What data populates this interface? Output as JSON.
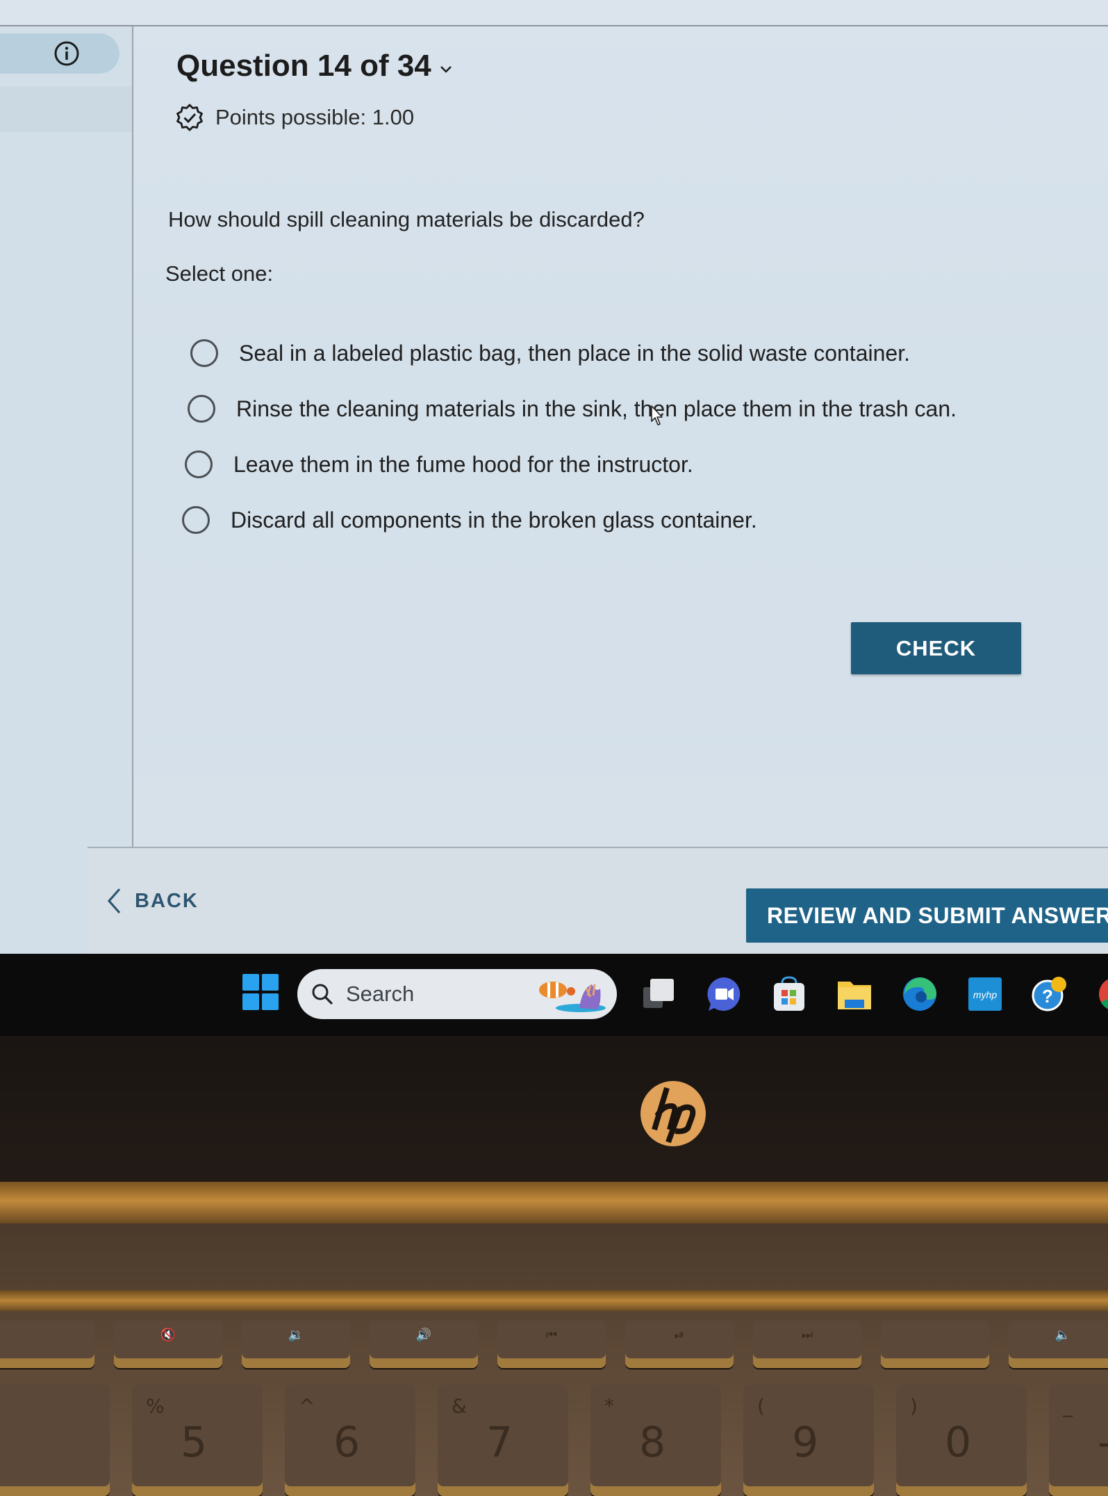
{
  "sidebar": {
    "info_icon": "info-circle-icon"
  },
  "header": {
    "question_title": "Question 14 of 34",
    "title_dropdown_icon": "chevron-down-icon",
    "points_icon": "verified-badge-icon",
    "points_text": "Points possible: 1.00"
  },
  "question": {
    "prompt": "How should spill cleaning materials be discarded?",
    "instruction": "Select one:",
    "options": [
      {
        "label": "Seal in a labeled plastic bag, then place in the solid waste container.",
        "selected": false
      },
      {
        "label": "Rinse the cleaning materials in the sink, then place them in the trash can.",
        "selected": false
      },
      {
        "label": "Leave them in the fume hood for the instructor.",
        "selected": false
      },
      {
        "label": "Discard all components in the broken glass container.",
        "selected": false
      }
    ]
  },
  "actions": {
    "check_label": "CHECK",
    "back_label": "BACK",
    "review_label": "REVIEW AND SUBMIT ANSWERS"
  },
  "colors": {
    "primary_button": "#1f5b7a",
    "review_button": "#1f6388",
    "back_text": "#2d5570",
    "screen_bg": "#d4e0ea"
  },
  "taskbar": {
    "search_placeholder": "Search",
    "icons": [
      "windows-start-icon",
      "search-icon",
      "task-view-icon",
      "meet-chat-icon",
      "microsoft-store-icon",
      "file-explorer-icon",
      "edge-browser-icon",
      "myhp-icon",
      "get-help-icon",
      "chrome-browser-icon"
    ],
    "myhp_label": "myhp"
  },
  "device": {
    "brand_logo": "hp",
    "fkeys": [
      "",
      "🔇",
      "🔉",
      "🔊",
      "⏮",
      "⏯",
      "⏭",
      "",
      "🔈"
    ],
    "numkeys": [
      {
        "shift": "",
        "main": ""
      },
      {
        "shift": "%",
        "main": "5"
      },
      {
        "shift": "^",
        "main": "6"
      },
      {
        "shift": "&",
        "main": "7"
      },
      {
        "shift": "*",
        "main": "8"
      },
      {
        "shift": "(",
        "main": "9"
      },
      {
        "shift": ")",
        "main": "0"
      },
      {
        "shift": "_",
        "main": "-"
      }
    ]
  }
}
